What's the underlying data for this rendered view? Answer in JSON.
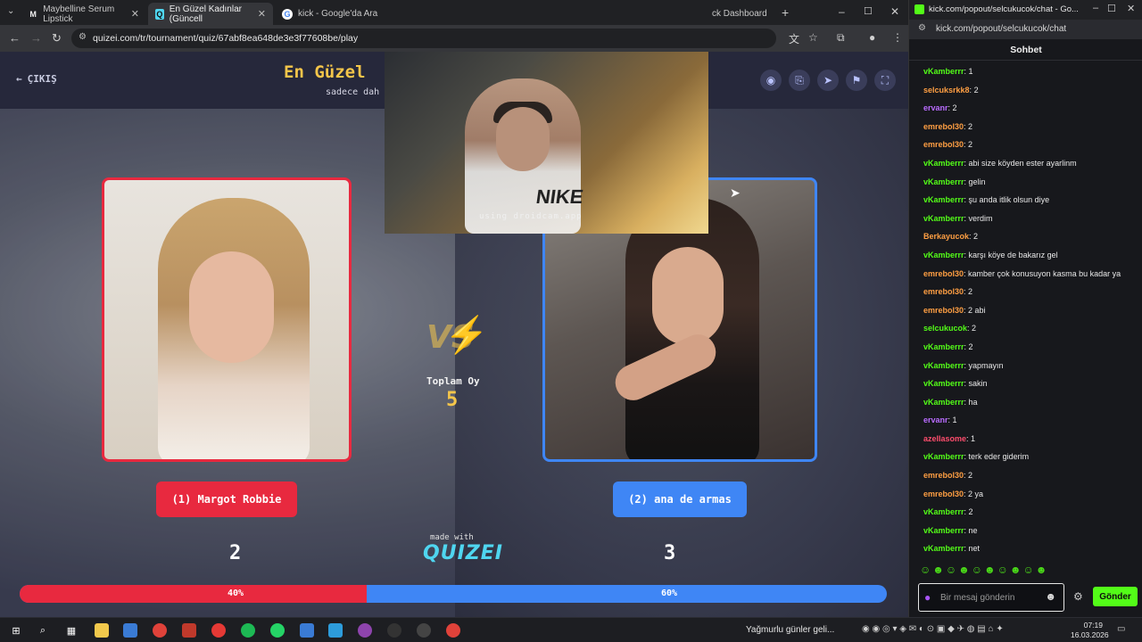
{
  "browser": {
    "tabs": [
      {
        "label": "Maybelline Serum Lipstick",
        "favicon": "M",
        "color": "#f0f0f0",
        "active": false
      },
      {
        "label": "En Güzel Kadınlar (Güncell",
        "favicon": "Q",
        "color": "#4fd6f0",
        "active": true
      },
      {
        "label": "kick - Google'da Ara",
        "favicon": "G",
        "color": "#4285f4",
        "active": false
      },
      {
        "label": "ck Dashboard",
        "favicon": "",
        "color": "",
        "active": false
      }
    ],
    "url": "quizei.com/tr/tournament/quiz/67abf8ea648de3e3f77608be/play"
  },
  "page": {
    "exit_label": "ÇIKIŞ",
    "title": "En Güzel",
    "subtitle": "sadece dah",
    "webcam_watermark": "using droidcam.app",
    "webcam_shirt": "NIKE",
    "left_choice": "(1) Margot Robbie",
    "right_choice": "(2) ana de armas",
    "total_label": "Toplam Oy",
    "total_value": "5",
    "left_votes": "2",
    "right_votes": "3",
    "made_with": "made with",
    "brand": "QUIZEI",
    "left_percent_label": "40%",
    "right_percent_label": "60%",
    "left_fraction": 0.4,
    "colors": {
      "red": "#e8293f",
      "blue": "#3f86f5",
      "gold": "#f5c64a"
    }
  },
  "chat": {
    "window_title": "kick.com/popout/selcukucok/chat - Go...",
    "url": "kick.com/popout/selcukucok/chat",
    "header": "Sohbet",
    "messages": [
      {
        "user": "vKamberrr",
        "color": "#53fc18",
        "text": "1"
      },
      {
        "user": "selcuksrkk8",
        "color": "#ff9f43",
        "text": "2"
      },
      {
        "user": "ervanr",
        "color": "#b96cff",
        "text": "2"
      },
      {
        "user": "emrebol30",
        "color": "#ff9f43",
        "text": "2"
      },
      {
        "user": "emrebol30",
        "color": "#ff9f43",
        "text": "2"
      },
      {
        "user": "vKamberrr",
        "color": "#53fc18",
        "text": "abi size köyden ester ayarlinm"
      },
      {
        "user": "vKamberrr",
        "color": "#53fc18",
        "text": "gelin"
      },
      {
        "user": "vKamberrr",
        "color": "#53fc18",
        "text": "şu anda itlik olsun diye"
      },
      {
        "user": "vKamberrr",
        "color": "#53fc18",
        "text": "verdim"
      },
      {
        "user": "Berkayucok",
        "color": "#ff9f43",
        "text": "2"
      },
      {
        "user": "vKamberrr",
        "color": "#53fc18",
        "text": "karşı köye de bakarız gel"
      },
      {
        "user": "emrebol30",
        "color": "#ff9f43",
        "text": "kamber çok konusuyon kasma bu kadar ya"
      },
      {
        "user": "emrebol30",
        "color": "#ff9f43",
        "text": "2"
      },
      {
        "user": "emrebol30",
        "color": "#ff9f43",
        "text": "2 abi"
      },
      {
        "user": "selcukucok",
        "color": "#53fc18",
        "text": "2"
      },
      {
        "user": "vKamberrr",
        "color": "#53fc18",
        "text": "2"
      },
      {
        "user": "vKamberrr",
        "color": "#53fc18",
        "text": "yapmayın"
      },
      {
        "user": "vKamberrr",
        "color": "#53fc18",
        "text": "sakin"
      },
      {
        "user": "vKamberrr",
        "color": "#53fc18",
        "text": "ha"
      },
      {
        "user": "ervanr",
        "color": "#b96cff",
        "text": "1"
      },
      {
        "user": "azellasome",
        "color": "#ff4d6d",
        "text": "1"
      },
      {
        "user": "vKamberrr",
        "color": "#53fc18",
        "text": "terk eder giderim"
      },
      {
        "user": "emrebol30",
        "color": "#ff9f43",
        "text": "2"
      },
      {
        "user": "emrebol30",
        "color": "#ff9f43",
        "text": "2 ya"
      },
      {
        "user": "vKamberrr",
        "color": "#53fc18",
        "text": "2"
      },
      {
        "user": "vKamberrr",
        "color": "#53fc18",
        "text": "ne"
      },
      {
        "user": "vKamberrr",
        "color": "#53fc18",
        "text": "net"
      }
    ],
    "input_placeholder": "Bir mesaj gönderin",
    "send_label": "Gönder"
  },
  "taskbar": {
    "weather": "Yağmurlu günler geli...",
    "time": "07:19",
    "date": "16.03.2026"
  }
}
